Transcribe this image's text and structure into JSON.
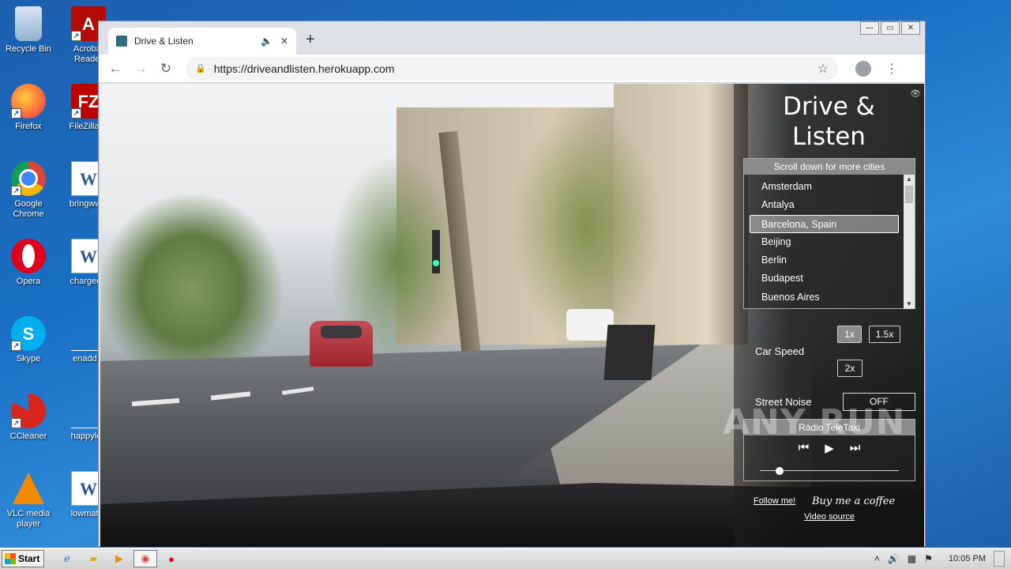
{
  "desktop": {
    "icons": [
      {
        "label": "Recycle Bin",
        "glyph": ""
      },
      {
        "label": "Acrobat Reader",
        "glyph": "A"
      },
      {
        "label": "Firefox",
        "glyph": ""
      },
      {
        "label": "FileZilla C",
        "glyph": "FZ"
      },
      {
        "label": "Google Chrome",
        "glyph": ""
      },
      {
        "label": "bringwww",
        "glyph": "W"
      },
      {
        "label": "Opera",
        "glyph": ""
      },
      {
        "label": "chargeciv",
        "glyph": "W"
      },
      {
        "label": "Skype",
        "glyph": "S"
      },
      {
        "label": "enadd.p",
        "glyph": ""
      },
      {
        "label": "CCleaner",
        "glyph": ""
      },
      {
        "label": "happylea",
        "glyph": ""
      },
      {
        "label": "VLC media player",
        "glyph": ""
      },
      {
        "label": "lowmatur",
        "glyph": "W"
      }
    ]
  },
  "browser": {
    "tab_title": "Drive & Listen",
    "new_tab": "+",
    "url": "https://driveandlisten.herokuapp.com",
    "controls": {
      "minimize": "—",
      "maximize": "▭",
      "close": "✕"
    }
  },
  "app": {
    "title": "Drive & Listen",
    "city_header": "Scroll down for more cities",
    "cities": [
      "Amsterdam",
      "Antalya",
      "Barcelona, Spain",
      "Beijing",
      "Berlin",
      "Budapest",
      "Buenos Aires"
    ],
    "selected_city": "Barcelona, Spain",
    "car_speed_label": "Car Speed",
    "speeds": [
      "1x",
      "1.5x",
      "2x"
    ],
    "active_speed": "1x",
    "street_noise_label": "Street Noise",
    "street_noise_value": "OFF",
    "radio_station": "Rádio TeleTaxi",
    "volume_fraction": 0.14,
    "follow_link": "Follow me!",
    "coffee_link": "Buy me a coffee",
    "video_source_link": "Video source"
  },
  "watermark": "ANY RUN",
  "taskbar": {
    "start_label": "Start",
    "clock": "10:05 PM"
  }
}
